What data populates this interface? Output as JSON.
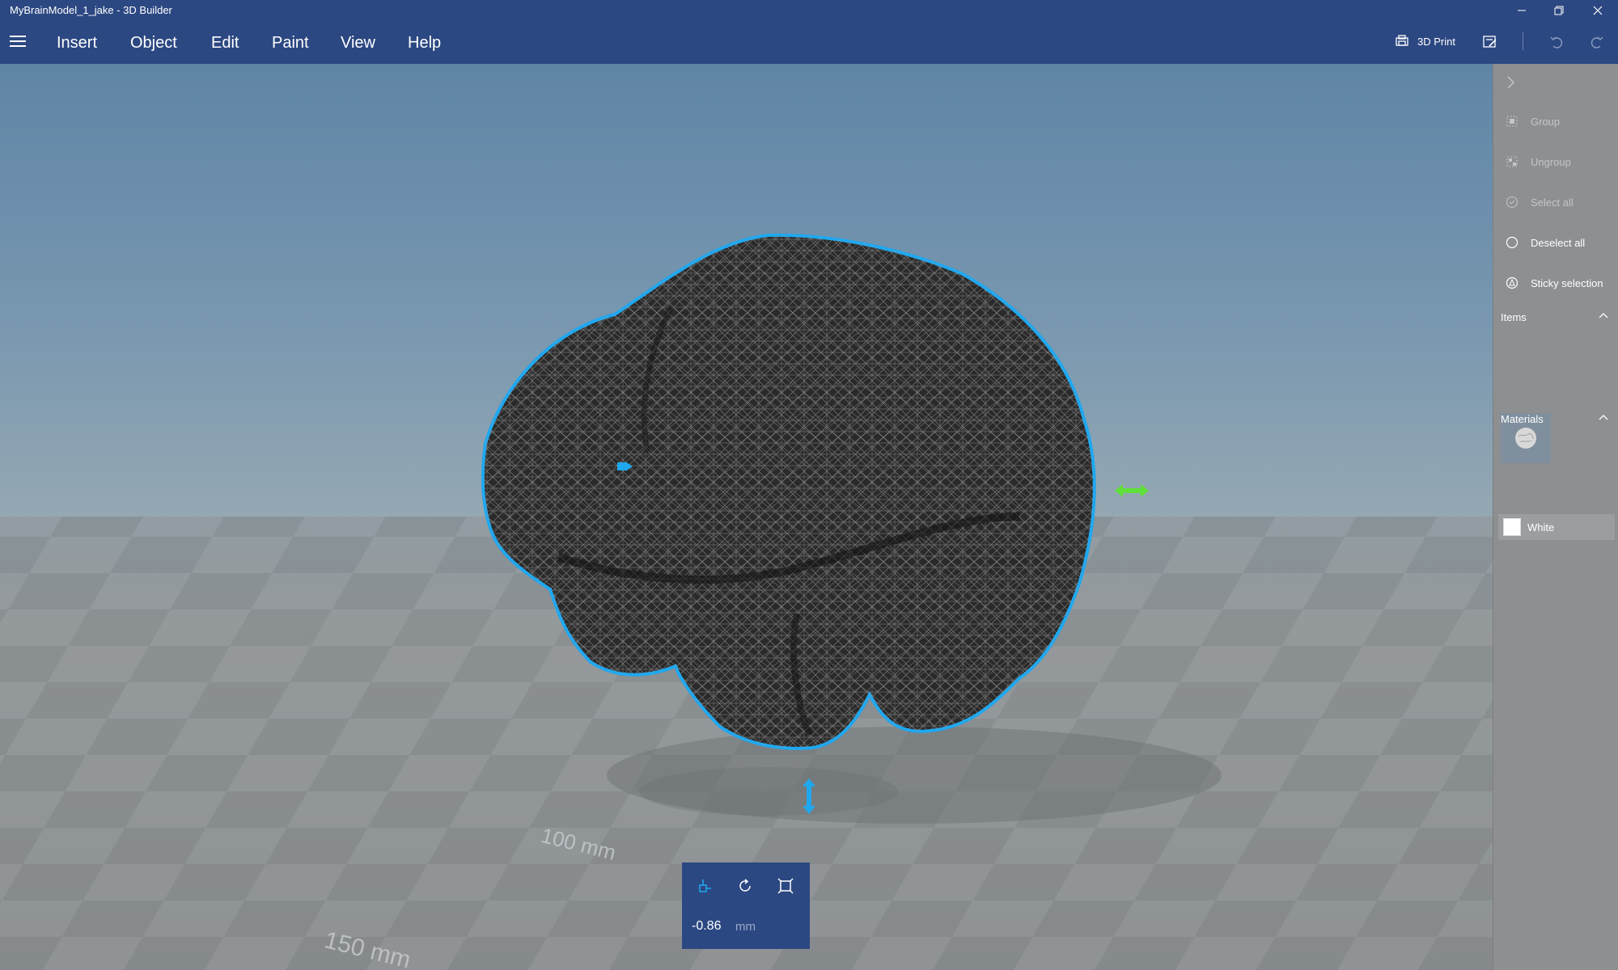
{
  "window": {
    "title": "MyBrainModel_1_jake - 3D Builder",
    "controls": [
      "minimize",
      "restore",
      "close"
    ]
  },
  "menubar": {
    "items": [
      "Insert",
      "Object",
      "Edit",
      "Paint",
      "View",
      "Help"
    ],
    "print_label": "3D Print"
  },
  "viewport": {
    "unit_labels": [
      "100 mm",
      "150 mm"
    ]
  },
  "sidepanel": {
    "actions": [
      {
        "label": "Group",
        "enabled": false,
        "icon": "group-icon"
      },
      {
        "label": "Ungroup",
        "enabled": false,
        "icon": "ungroup-icon"
      },
      {
        "label": "Select all",
        "enabled": false,
        "icon": "select-all-icon"
      },
      {
        "label": "Deselect all",
        "enabled": true,
        "icon": "deselect-all-icon"
      },
      {
        "label": "Sticky selection",
        "enabled": true,
        "icon": "sticky-selection-icon"
      }
    ],
    "items_label": "Items",
    "materials_label": "Materials",
    "material_name": "White"
  },
  "gizmo": {
    "value": "-0.86",
    "unit": "mm",
    "modes": [
      "move-icon",
      "rotate-icon",
      "scale-icon"
    ]
  },
  "colors": {
    "accent": "#2c4882",
    "selection": "#1fa8f0",
    "handle_green": "#5fe03a"
  }
}
